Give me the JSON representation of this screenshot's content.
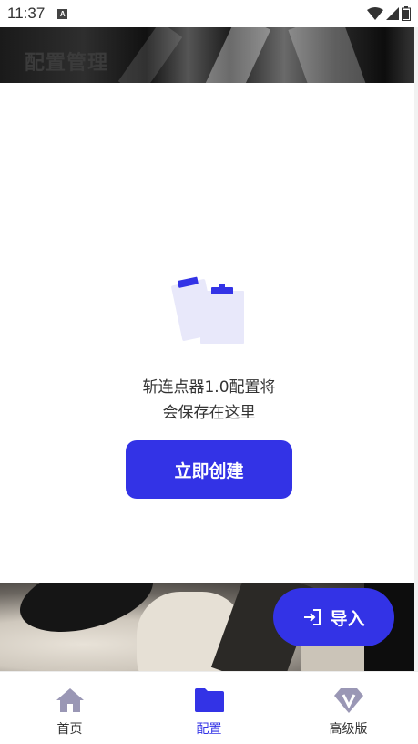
{
  "status_bar": {
    "time": "11:37",
    "notification_icon": "a-icon",
    "icons": [
      "wifi-icon",
      "signal-icon",
      "battery-icon"
    ]
  },
  "header": {
    "title": "配置管理"
  },
  "empty_state": {
    "icon": "clipboard-icon",
    "message_line1": "斩连点器1.0配置将",
    "message_line2": "会保存在这里",
    "create_button_label": "立即创建"
  },
  "fab": {
    "icon": "login-arrow-icon",
    "label": "导入"
  },
  "bottom_nav": {
    "items": [
      {
        "label": "首页",
        "icon": "home-icon",
        "active": false
      },
      {
        "label": "配置",
        "icon": "folder-icon",
        "active": true
      },
      {
        "label": "高级版",
        "icon": "v-diamond-icon",
        "active": false
      }
    ]
  },
  "colors": {
    "accent": "#3333e6",
    "nav_inactive_icon": "#9a97b5",
    "clipboard_light": "#e8e8fa"
  }
}
